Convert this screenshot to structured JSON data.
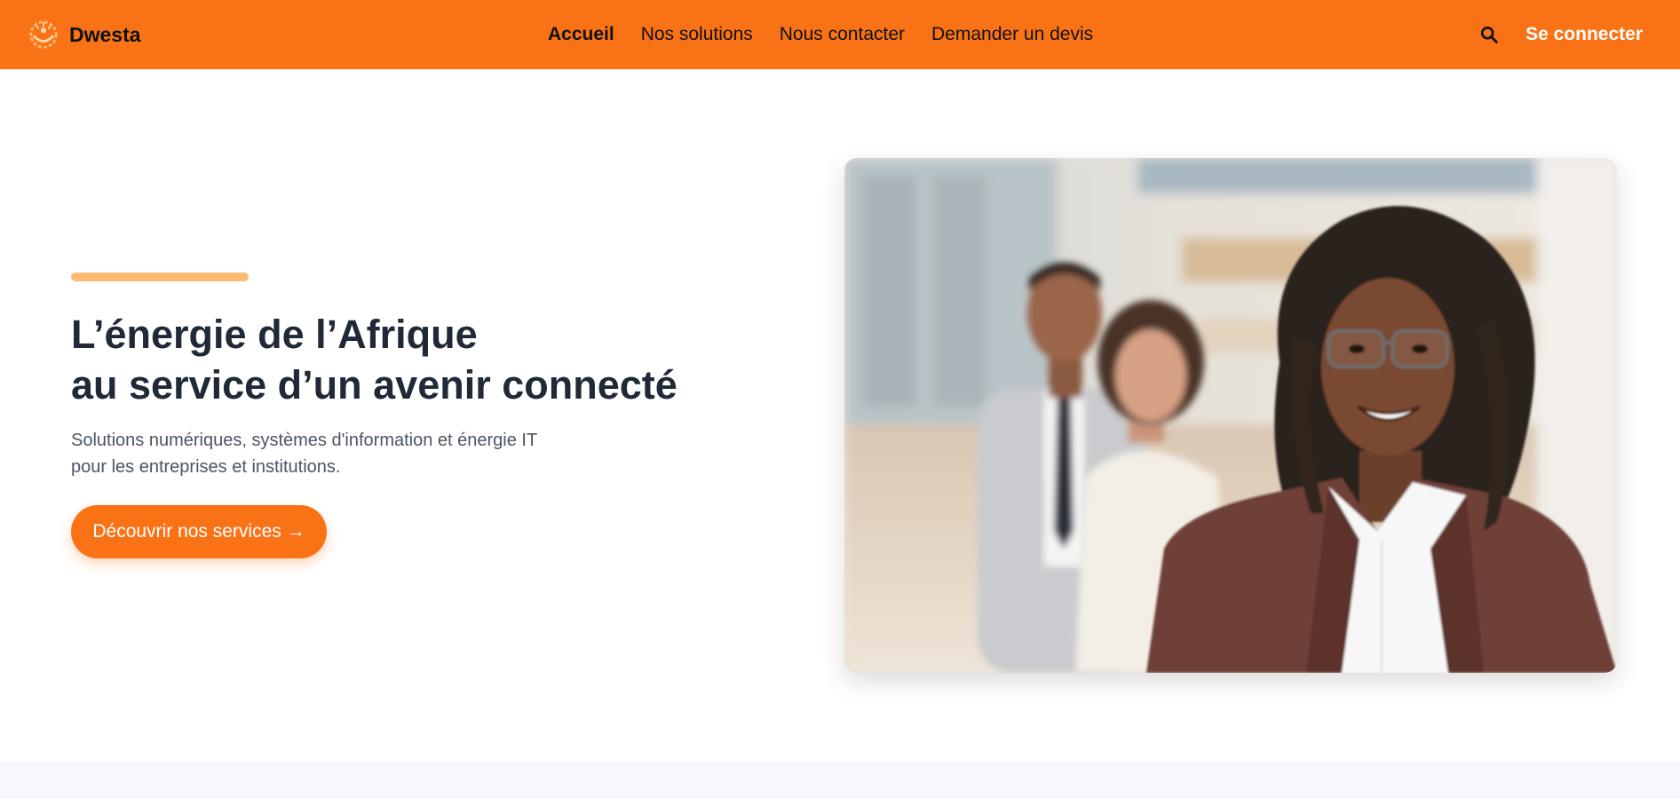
{
  "brand": {
    "name": "Dwesta",
    "logo_icon": "sun-emblem-icon"
  },
  "nav": {
    "items": [
      {
        "label": "Accueil",
        "active": true
      },
      {
        "label": "Nos solutions",
        "active": false
      },
      {
        "label": "Nous contacter",
        "active": false
      },
      {
        "label": "Demander un devis",
        "active": false
      }
    ]
  },
  "header": {
    "search_icon": "search-icon",
    "login_label": "Se connecter"
  },
  "hero": {
    "title_line1": "L’énergie de l’Afrique",
    "title_line2": "au service d’un avenir connecté",
    "subtitle_line1": "Solutions numériques, systèmes d'information et énergie IT",
    "subtitle_line2": "pour les entreprises et institutions.",
    "cta_label": "Découvrir nos services →",
    "photo_icon": "team-photo"
  },
  "colors": {
    "brand_orange": "#f97316",
    "accent_light_orange": "#fdba74",
    "title_dark": "#1f2937",
    "subtitle_gray": "#4b5563",
    "section_bg": "#f7f7fc"
  }
}
